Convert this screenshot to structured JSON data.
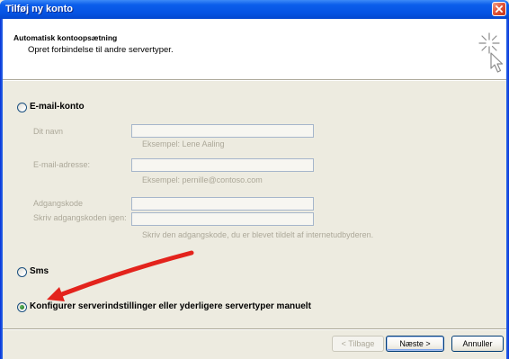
{
  "window": {
    "title": "Tilføj ny konto",
    "close_icon": "close-icon"
  },
  "header": {
    "title": "Automatisk kontoopsætning",
    "subtitle": "Opret forbindelse til andre servertyper.",
    "icon": "sparkle-cursor-icon"
  },
  "options": {
    "email": {
      "label": "E-mail-konto",
      "selected": false
    },
    "sms": {
      "label": "Sms",
      "selected": false
    },
    "manual": {
      "label": "Konfigurer serverindstillinger eller yderligere servertyper manuelt",
      "selected": true
    }
  },
  "email_form": {
    "disabled": true,
    "name": {
      "label": "Dit navn",
      "value": "",
      "hint": "Eksempel: Lene Aaling"
    },
    "email": {
      "label": "E-mail-adresse:",
      "value": "",
      "hint": "Eksempel: pernille@contoso.com"
    },
    "password": {
      "label": "Adgangskode",
      "value": ""
    },
    "password_repeat": {
      "label": "Skriv adgangskoden igen:",
      "value": "",
      "hint": "Skriv den adgangskode, du er blevet tildelt af internetudbyderen."
    }
  },
  "buttons": {
    "back": {
      "label": "< Tilbage",
      "disabled": true
    },
    "next": {
      "label": "Næste >",
      "disabled": false,
      "focused": true
    },
    "cancel": {
      "label": "Annuller",
      "disabled": false
    }
  },
  "annotation": {
    "arrow_color": "#E3231C"
  }
}
